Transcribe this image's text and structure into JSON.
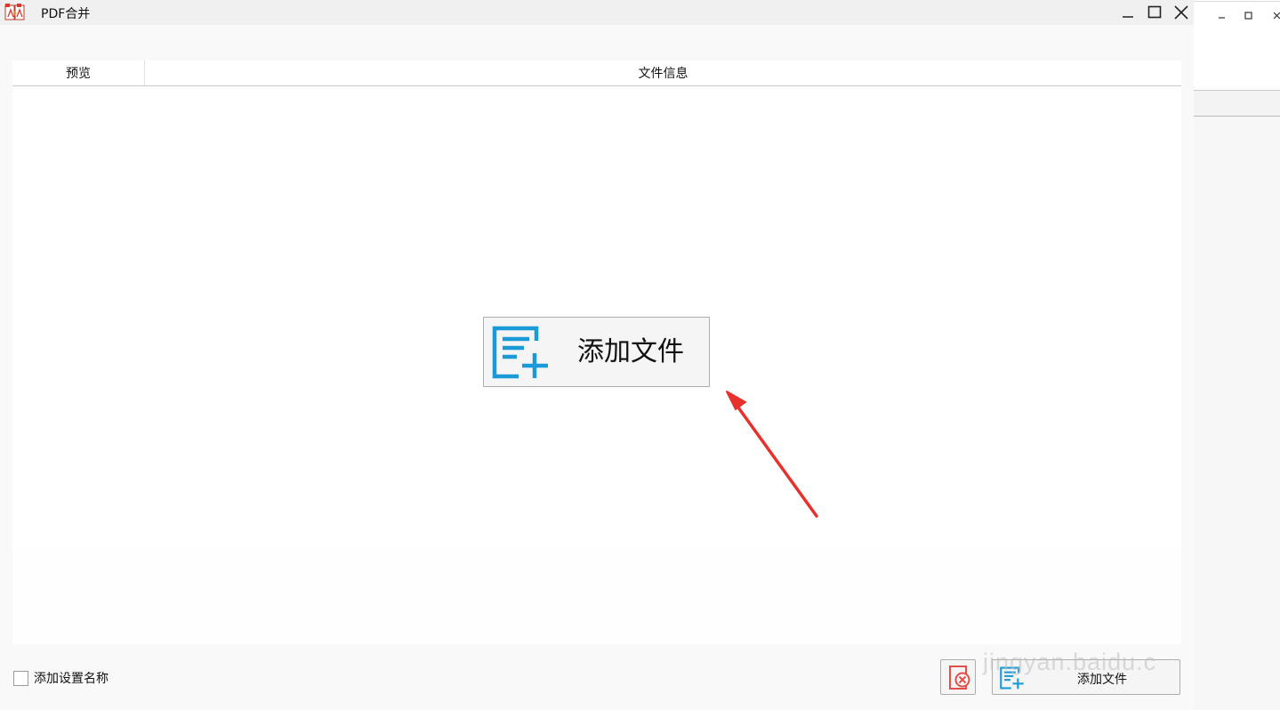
{
  "window": {
    "title": "PDF合并",
    "minimize_icon": "minimize-icon",
    "maximize_icon": "maximize-icon",
    "close_icon": "close-icon"
  },
  "list": {
    "columns": [
      {
        "label": "预览"
      },
      {
        "label": "文件信息"
      }
    ],
    "rows": []
  },
  "center_add_button": {
    "label": "添加文件",
    "icon": "add-file-icon",
    "icon_color": "#1a9ad6"
  },
  "annotation": {
    "arrow_color": "#e8312c"
  },
  "footer": {
    "checkbox_label": "添加设置名称",
    "checkbox_checked": false,
    "clear_button_icon": "clear-list-icon",
    "clear_icon_color": "#e0504a",
    "add_button_label": "添加文件",
    "add_button_icon": "add-file-icon"
  },
  "watermark": "jingyan.baidu.c",
  "background_window": {
    "minimize_icon": "minimize-icon",
    "maximize_icon": "maximize-icon",
    "close_icon": "close-icon"
  }
}
